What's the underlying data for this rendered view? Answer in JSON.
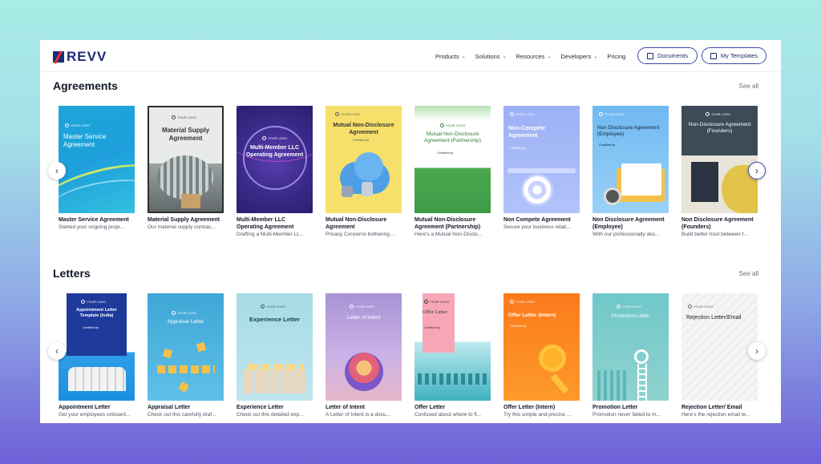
{
  "brand": {
    "name": "REVV"
  },
  "nav": {
    "links": [
      {
        "label": "Products",
        "has_dropdown": true
      },
      {
        "label": "Solutions",
        "has_dropdown": true
      },
      {
        "label": "Resources",
        "has_dropdown": true
      },
      {
        "label": "Developers",
        "has_dropdown": true
      },
      {
        "label": "Pricing",
        "has_dropdown": false
      }
    ],
    "documents_button": "Documents",
    "templates_button": "My Templates"
  },
  "agreements": {
    "title": "Agreements",
    "see_all": "See all",
    "cards": [
      {
        "title": "Master Service Agreement",
        "desc": "Started your ongoing proje...",
        "thumb_text": "Master Service Agreement",
        "logo": "YOUR LOGO"
      },
      {
        "title": "Material Supply Agreement",
        "desc": "Our material supply contrac...",
        "thumb_text": "Material Supply Agreement",
        "logo": "YOUR LOGO"
      },
      {
        "title": "Multi-Member LLC Operating Agreement",
        "desc": "Drafting a Multi-Member LL...",
        "thumb_text": "Multi-Member LLC Operating Agreement",
        "logo": "YOUR LOGO"
      },
      {
        "title": "Mutual Non-Disclosure Agreement",
        "desc": "Privacy Concerns bothering ...",
        "thumb_text": "Mutual Non-Disclosure Agreement",
        "logo": "YOUR LOGO",
        "certified": "Certified by"
      },
      {
        "title": "Mutual Non-Disclosure Agreement (Partnership)",
        "desc": "Here's a Mutual Non-Disclo...",
        "thumb_text": "Mutual Non-Disclosure Agreement (Partnership)",
        "logo": "YOUR LOGO",
        "certified": "Certified by"
      },
      {
        "title": "Non Compete Agreement",
        "desc": "Secure your business relati...",
        "thumb_text": "Non-Compete Agreement",
        "logo": "YOUR LOGO",
        "certified": "Certified by"
      },
      {
        "title": "Non Disclosure Agreement (Employee)",
        "desc": "With our professionally des...",
        "thumb_text": "Non Disclosure Agreement (Employee)",
        "logo": "YOUR LOGO",
        "certified": "Certified by"
      },
      {
        "title": "Non Disclosure Agreement (Founders)",
        "desc": "Build better trust between f...",
        "thumb_text": "Non-Disclosure Agreement (Founders)",
        "logo": "YOUR LOGO"
      }
    ]
  },
  "letters": {
    "title": "Letters",
    "see_all": "See all",
    "cards": [
      {
        "title": "Appointment Letter",
        "desc": "Get your employees onboard...",
        "thumb_text": "Appointment Letter Template (India)",
        "logo": "YOUR LOGO",
        "certified": "Certified by"
      },
      {
        "title": "Appraisal Letter",
        "desc": "Check out this carefully draf...",
        "thumb_text": "Appraisal Letter",
        "logo": "YOUR LOGO"
      },
      {
        "title": "Experience Letter",
        "desc": "Check out this detailed exp...",
        "thumb_text": "Experience Letter",
        "logo": "YOUR LOGO"
      },
      {
        "title": "Letter of Intent",
        "desc": "A Letter of Intent is a docu...",
        "thumb_text": "Letter of Intent",
        "logo": "YOUR LOGO"
      },
      {
        "title": "Offer Letter",
        "desc": "Confused about where to fi...",
        "thumb_text": "Offer Letter",
        "logo": "YOUR LOGO",
        "certified": "Certified by"
      },
      {
        "title": "Offer Letter (Intern)",
        "desc": "Try this simple and precise ...",
        "thumb_text": "Offer Letter (Intern)",
        "logo": "YOUR LOGO",
        "certified": "Certified by"
      },
      {
        "title": "Promotion Letter",
        "desc": "Promotion never failed to m...",
        "thumb_text": "Promotion Letter",
        "logo": "YOUR LOGO"
      },
      {
        "title": "Rejection Letter/ Email",
        "desc": "Here's the rejection email te...",
        "thumb_text": "Rejection Letter/Email",
        "logo": "YOUR LOGO"
      }
    ]
  },
  "colors": {
    "brand": "#1c2a7a",
    "accent": "#3b4aa8"
  }
}
